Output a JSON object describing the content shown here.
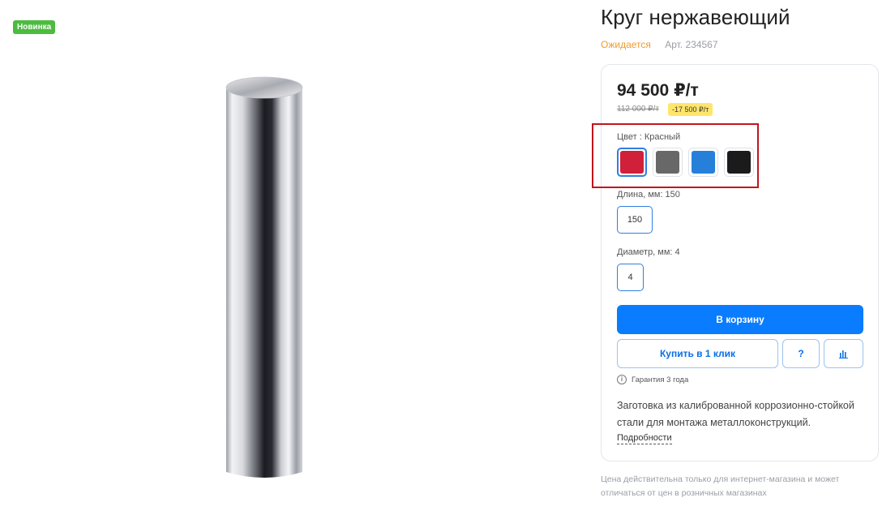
{
  "badge": "Новинка",
  "product": {
    "title": "Круг нержавеющий",
    "status": "Ожидается",
    "sku": "Арт. 234567"
  },
  "pricing": {
    "price": "94 500 ₽/т",
    "old_price": "112 000 ₽/т",
    "discount": "-17 500 ₽/т"
  },
  "options": {
    "color_label": "Цвет : Красный",
    "colors": [
      {
        "name": "red",
        "hex": "#d0203a",
        "selected": true
      },
      {
        "name": "gray",
        "hex": "#686868",
        "selected": false
      },
      {
        "name": "blue",
        "hex": "#2680d9",
        "selected": false
      },
      {
        "name": "black",
        "hex": "#1b1b1b",
        "selected": false
      }
    ],
    "length_label": "Длина, мм: 150",
    "length_value": "150",
    "diameter_label": "Диаметр, мм: 4",
    "diameter_value": "4"
  },
  "actions": {
    "cart": "В корзину",
    "one_click": "Купить в 1 клик",
    "question": "?",
    "compare_icon": "bar-chart-icon"
  },
  "warranty": {
    "icon": "info-icon",
    "icon_glyph": "i",
    "text": "Гарантия 3 года"
  },
  "description": "Заготовка из калиброванной коррозионно-стойкой стали для монтажа металлоконструкций.",
  "details_link": "Подробности",
  "disclaimer": "Цена действительна только для интернет-магазина и может отличаться от цен в розничных магазинах",
  "colors": {
    "accent": "#0a7cff",
    "status": "#f39a2b",
    "badge": "#4cbb3f",
    "discount_bg": "#ffe66b",
    "highlight": "#c0161c"
  }
}
